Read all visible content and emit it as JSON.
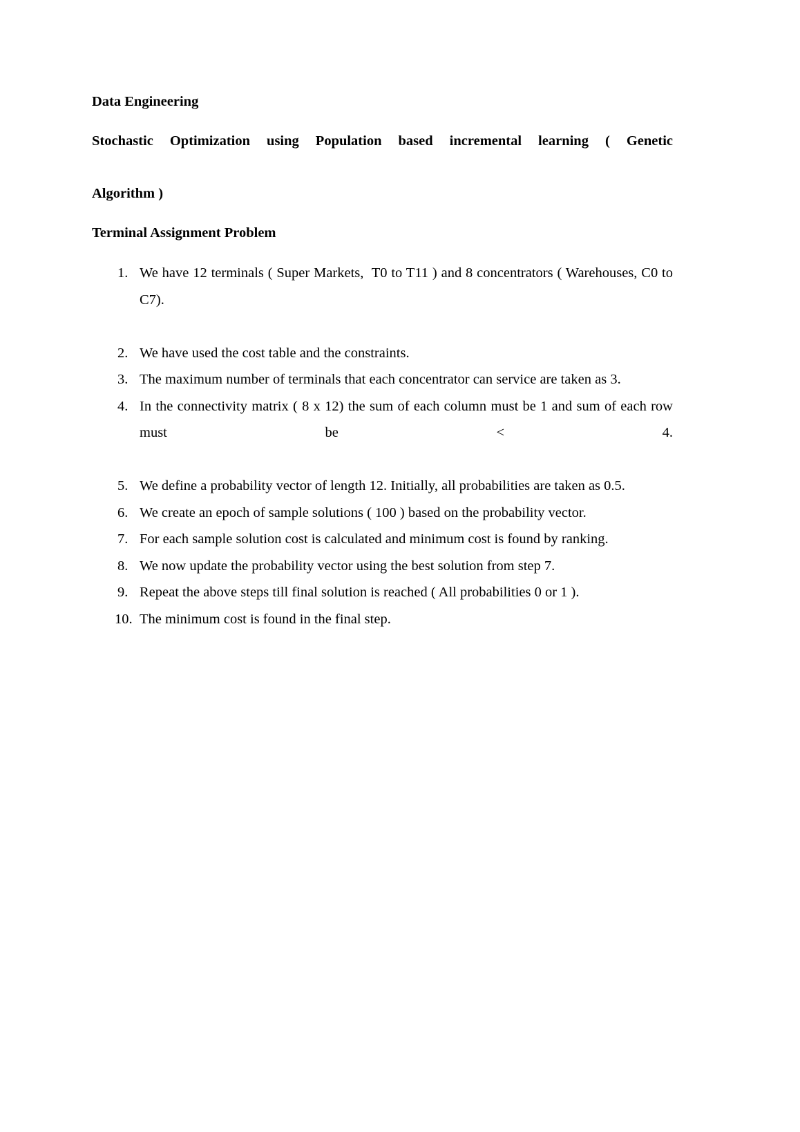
{
  "document": {
    "background_color": "#ffffff",
    "text_color": "#000000"
  },
  "headings": {
    "doc_title": "Data Engineering",
    "subject_title_line1": "Stochastic Optimization using Population based incremental learning ( Genetic",
    "subject_title_line2": "Algorithm )",
    "subject_title_full": "Stochastic Optimization using Population based incremental learning ( Genetic Algorithm )",
    "section_title": "Terminal Assignment Problem"
  },
  "steps": {
    "items": [
      {
        "number": "1.",
        "text": "We have 12 terminals ( Super Markets,  T0 to T11 ) and 8 concentrators ( Warehouses, C0 to C7)."
      },
      {
        "number": "2.",
        "text": "We have used the cost table and the constraints."
      },
      {
        "number": "3.",
        "text": "The maximum number of terminals that each concentrator can service are taken as 3."
      },
      {
        "number": "4.",
        "text": "In the connectivity matrix ( 8 x 12) the sum of each column must be 1 and sum of each row must be < 4."
      },
      {
        "number": "5.",
        "text": "We define a probability vector of length 12. Initially, all probabilities are taken as 0.5."
      },
      {
        "number": "6.",
        "text": "We create an epoch of sample solutions ( 100 ) based on the probability vector."
      },
      {
        "number": "7.",
        "text": "For each sample solution cost is calculated and minimum cost is found by ranking."
      },
      {
        "number": "8.",
        "text": "We now update the probability vector using the best solution from step 7."
      },
      {
        "number": "9.",
        "text": "Repeat the above steps till final solution is reached ( All probabilities 0 or 1 )."
      },
      {
        "number": "10.",
        "text": "The minimum cost is found in the final step."
      }
    ]
  }
}
